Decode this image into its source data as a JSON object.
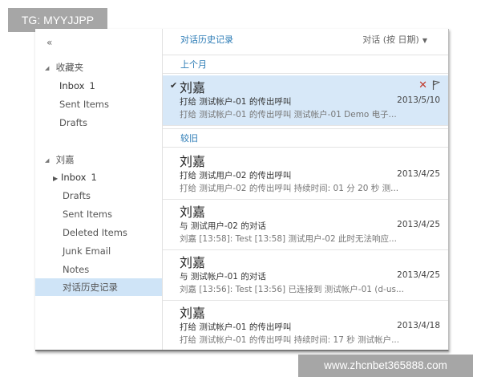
{
  "watermarks": {
    "top_left": "TG: MYYJJPP",
    "bottom_right": "www.zhcnbet365888.com"
  },
  "sidebar": {
    "collapse_glyph": "«",
    "favorites": {
      "header": "收藏夹",
      "items": [
        {
          "label": "Inbox",
          "count": "1"
        },
        {
          "label": "Sent Items"
        },
        {
          "label": "Drafts"
        }
      ]
    },
    "account": {
      "header": "刘嘉",
      "items": [
        {
          "label": "Inbox",
          "count": "1"
        },
        {
          "label": "Drafts"
        },
        {
          "label": "Sent Items"
        },
        {
          "label": "Deleted Items"
        },
        {
          "label": "Junk Email"
        },
        {
          "label": "Notes"
        },
        {
          "label": "对话历史记录"
        }
      ]
    }
  },
  "main": {
    "title": "对话历史记录",
    "sort_label": "对话 (按 日期)",
    "sections": [
      {
        "label": "上个月"
      },
      {
        "label": "较旧"
      }
    ],
    "conversations": [
      {
        "sender": "刘嘉",
        "subject": "打给 测试帐户-01 的传出呼叫",
        "date": "2013/5/10",
        "preview": "打给 测试帐户-01 的传出呼叫 测试帐户-01 Demo 电子..."
      },
      {
        "sender": "刘嘉",
        "subject": "打给 测试用户-02 的传出呼叫",
        "date": "2013/4/25",
        "preview": "打给 测试用户-02 的传出呼叫 持续时间: 01 分 20 秒 测..."
      },
      {
        "sender": "刘嘉",
        "subject": "与 测试用户-02 的对话",
        "date": "2013/4/25",
        "preview": "刘嘉 [13:58]: Test [13:58] 测试用户-02 此时无法响应..."
      },
      {
        "sender": "刘嘉",
        "subject": "与 测试帐户-01 的对话",
        "date": "2013/4/25",
        "preview": "刘嘉 [13:56]: Test [13:56] 已连接到 测试帐户-01 (d-us..."
      },
      {
        "sender": "刘嘉",
        "subject": "打给 测试帐户-01 的传出呼叫",
        "date": "2013/4/18",
        "preview": "打给 测试帐户-01 的传出呼叫 持续时间: 17 秒 测试帐户..."
      }
    ]
  },
  "colors": {
    "accent": "#2a7ab5",
    "selected_bg": "#d7e8f8",
    "delete": "#c0392b"
  }
}
